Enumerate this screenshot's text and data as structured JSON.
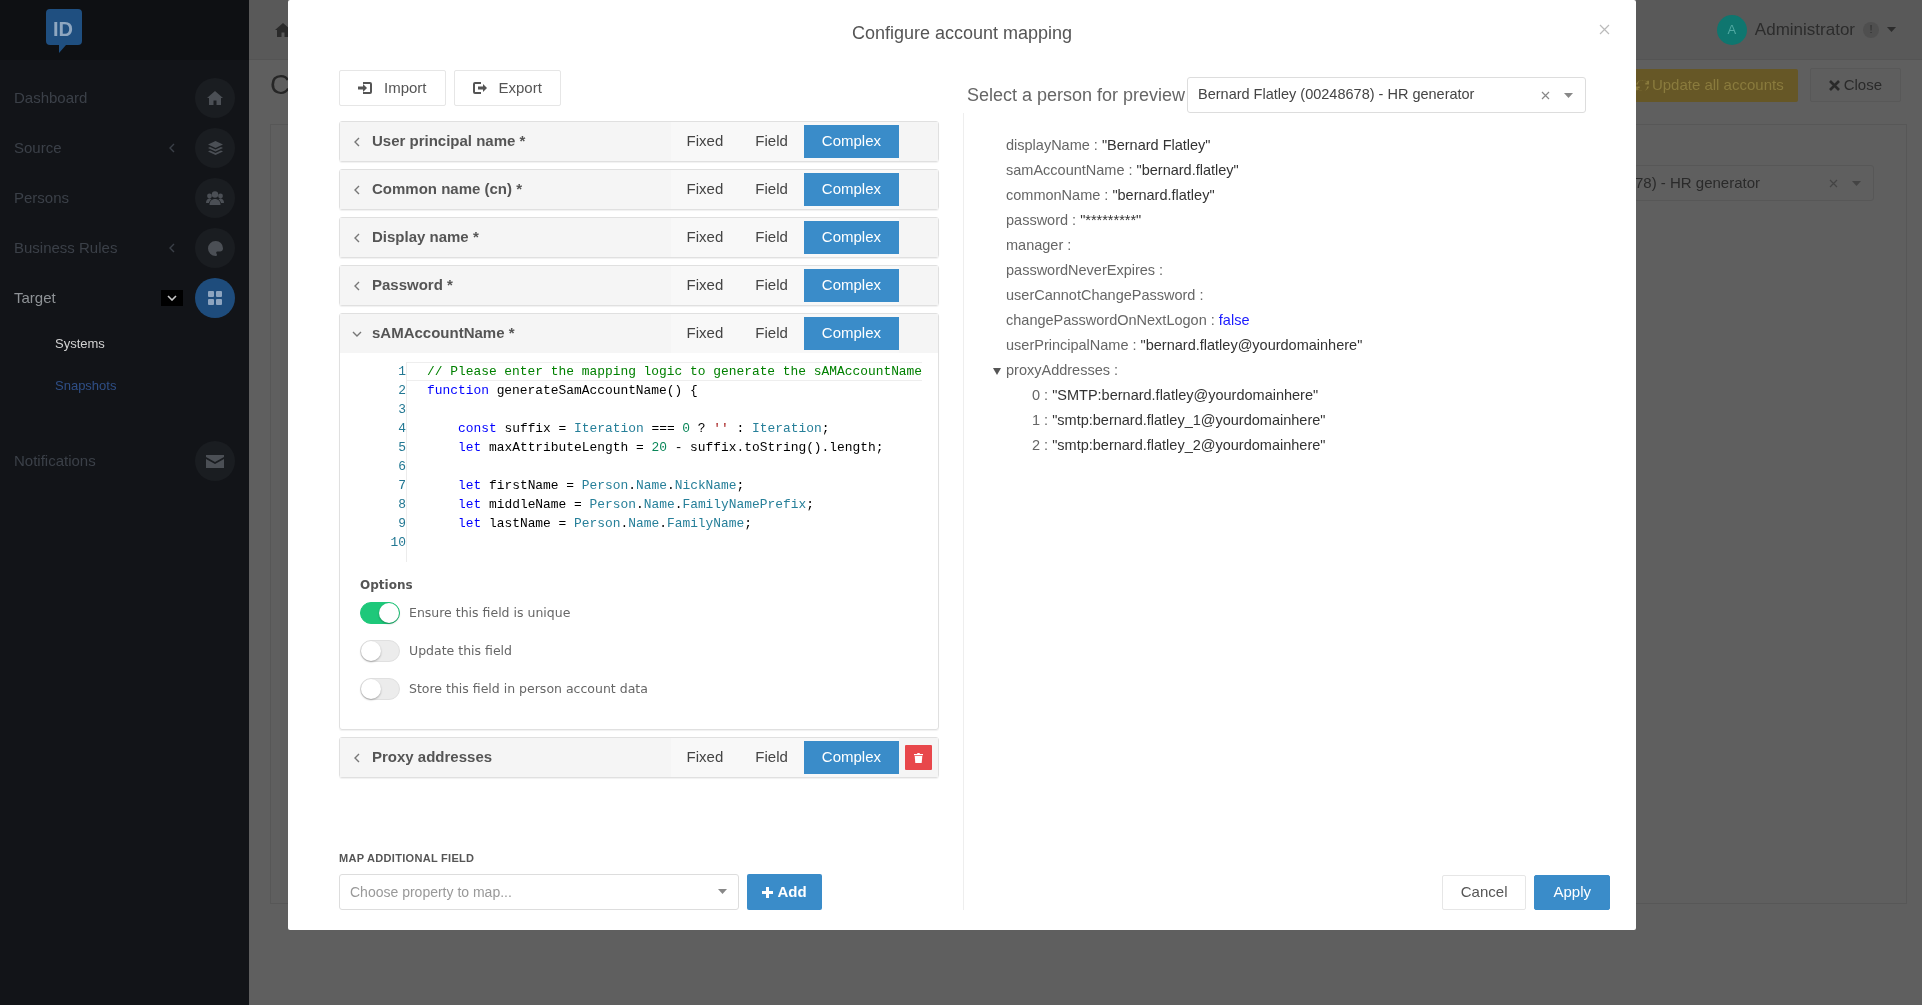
{
  "sidebar": {
    "logo": "ID",
    "items": [
      {
        "label": "Dashboard",
        "kind": "link",
        "selected": false
      },
      {
        "label": "Source",
        "kind": "group",
        "expanded": false,
        "selected": false
      },
      {
        "label": "Persons",
        "kind": "link",
        "selected": false
      },
      {
        "label": "Business Rules",
        "kind": "group",
        "expanded": false,
        "selected": false
      },
      {
        "label": "Target",
        "kind": "group",
        "expanded": true,
        "selected": true,
        "children": [
          {
            "label": "Systems",
            "selected": true
          },
          {
            "label": "Snapshots",
            "selected": false
          }
        ]
      },
      {
        "label": "Notifications",
        "kind": "link",
        "selected": false
      }
    ]
  },
  "background": {
    "title": "C",
    "user": {
      "avatar": "A",
      "name": "Administrator",
      "badge": "!"
    },
    "buttons": [
      "Update all accounts",
      "Close"
    ],
    "select_value": "78) - HR generator"
  },
  "modal": {
    "title": "Configure account mapping",
    "toolbar": [
      "Import",
      "Export"
    ],
    "mappings": [
      {
        "label": "User principal name *",
        "expanded": false,
        "deletable": false,
        "modes": [
          {
            "label": "Fixed",
            "selected": false
          },
          {
            "label": "Field",
            "selected": false
          },
          {
            "label": "Complex",
            "selected": true
          }
        ]
      },
      {
        "label": "Common name (cn) *",
        "expanded": false,
        "deletable": false,
        "modes": [
          {
            "label": "Fixed",
            "selected": false
          },
          {
            "label": "Field",
            "selected": false
          },
          {
            "label": "Complex",
            "selected": true
          }
        ]
      },
      {
        "label": "Display name *",
        "expanded": false,
        "deletable": false,
        "modes": [
          {
            "label": "Fixed",
            "selected": false
          },
          {
            "label": "Field",
            "selected": false
          },
          {
            "label": "Complex",
            "selected": true
          }
        ]
      },
      {
        "label": "Password *",
        "expanded": false,
        "deletable": false,
        "modes": [
          {
            "label": "Fixed",
            "selected": false
          },
          {
            "label": "Field",
            "selected": false
          },
          {
            "label": "Complex",
            "selected": true
          }
        ]
      },
      {
        "label": "sAMAccountName *",
        "expanded": true,
        "deletable": false,
        "modes": [
          {
            "label": "Fixed",
            "selected": false
          },
          {
            "label": "Field",
            "selected": false
          },
          {
            "label": "Complex",
            "selected": true
          }
        ],
        "code": [
          {
            "number": "1",
            "tokens": [
              {
                "text": "// Please enter the mapping logic to generate the sAMAccountName",
                "kind": "comment"
              }
            ]
          },
          {
            "number": "2",
            "tokens": [
              {
                "text": "function",
                "kind": "keyword"
              },
              {
                "text": " generateSamAccountName() {",
                "kind": "plain"
              }
            ]
          },
          {
            "number": "3"
          },
          {
            "number": "4",
            "indented": true,
            "tokens": [
              {
                "text": "const",
                "kind": "keyword"
              },
              {
                "text": " suffix = ",
                "kind": "plain"
              },
              {
                "text": "Iteration",
                "kind": "identifier"
              },
              {
                "text": " === ",
                "kind": "plain"
              },
              {
                "text": "0",
                "kind": "number"
              },
              {
                "text": " ? ",
                "kind": "plain"
              },
              {
                "text": "''",
                "kind": "string"
              },
              {
                "text": " : ",
                "kind": "plain"
              },
              {
                "text": "Iteration",
                "kind": "identifier"
              },
              {
                "text": ";",
                "kind": "plain"
              }
            ]
          },
          {
            "number": "5",
            "indented": true,
            "tokens": [
              {
                "text": "let",
                "kind": "keyword"
              },
              {
                "text": " maxAttributeLength = ",
                "kind": "plain"
              },
              {
                "text": "20",
                "kind": "number"
              },
              {
                "text": " - suffix.toString().length;",
                "kind": "plain"
              }
            ]
          },
          {
            "number": "6"
          },
          {
            "number": "7",
            "indented": true,
            "tokens": [
              {
                "text": "let",
                "kind": "keyword"
              },
              {
                "text": " firstName = ",
                "kind": "plain"
              },
              {
                "text": "Person",
                "kind": "identifier"
              },
              {
                "text": ".",
                "kind": "plain"
              },
              {
                "text": "Name",
                "kind": "identifier"
              },
              {
                "text": ".",
                "kind": "plain"
              },
              {
                "text": "NickName",
                "kind": "identifier"
              },
              {
                "text": ";",
                "kind": "plain"
              }
            ]
          },
          {
            "number": "8",
            "indented": true,
            "tokens": [
              {
                "text": "let",
                "kind": "keyword"
              },
              {
                "text": " middleName = ",
                "kind": "plain"
              },
              {
                "text": "Person",
                "kind": "identifier"
              },
              {
                "text": ".",
                "kind": "plain"
              },
              {
                "text": "Name",
                "kind": "identifier"
              },
              {
                "text": ".",
                "kind": "plain"
              },
              {
                "text": "FamilyNamePrefix",
                "kind": "identifier"
              },
              {
                "text": ";",
                "kind": "plain"
              }
            ]
          },
          {
            "number": "9",
            "indented": true,
            "tokens": [
              {
                "text": "let",
                "kind": "keyword"
              },
              {
                "text": " lastName = ",
                "kind": "plain"
              },
              {
                "text": "Person",
                "kind": "identifier"
              },
              {
                "text": ".",
                "kind": "plain"
              },
              {
                "text": "Name",
                "kind": "identifier"
              },
              {
                "text": ".",
                "kind": "plain"
              },
              {
                "text": "FamilyName",
                "kind": "identifier"
              },
              {
                "text": ";",
                "kind": "plain"
              }
            ]
          },
          {
            "number": "10"
          }
        ],
        "options_label": "Options",
        "options": [
          {
            "label": "Ensure this field is unique",
            "on": true
          },
          {
            "label": "Update this field",
            "on": false
          },
          {
            "label": "Store this field in person account data",
            "on": false
          }
        ]
      },
      {
        "label": "Proxy addresses",
        "expanded": false,
        "deletable": true,
        "modes": [
          {
            "label": "Fixed",
            "selected": false
          },
          {
            "label": "Field",
            "selected": false
          },
          {
            "label": "Complex",
            "selected": true
          }
        ]
      }
    ],
    "additional_field": {
      "label": "MAP ADDITIONAL FIELD",
      "placeholder": "Choose property to map...",
      "button": "Add"
    },
    "preview": {
      "label": "Select a person for preview",
      "value": "Bernard Flatley (00248678) - HR generator",
      "fields": [
        {
          "key": "displayName :",
          "value": "\"Bernard Flatley\"",
          "kind": "string"
        },
        {
          "key": "samAccountName :",
          "value": "\"bernard.flatley\"",
          "kind": "string"
        },
        {
          "key": "commonName :",
          "value": "\"bernard.flatley\"",
          "kind": "string"
        },
        {
          "key": "password :",
          "value": "\"*********\"",
          "kind": "string"
        },
        {
          "key": "manager :",
          "kind": "empty"
        },
        {
          "key": "passwordNeverExpires :",
          "kind": "empty"
        },
        {
          "key": "userCannotChangePassword :",
          "kind": "empty"
        },
        {
          "key": "changePasswordOnNextLogon :",
          "value": "false",
          "kind": "boolean"
        },
        {
          "key": "userPrincipalName :",
          "value": "\"bernard.flatley@yourdomainhere\"",
          "kind": "string"
        },
        {
          "key": "proxyAddresses :",
          "kind": "array",
          "expanded": true,
          "children": [
            {
              "key": "0 :",
              "value": "\"SMTP:bernard.flatley@yourdomainhere\"",
              "kind": "string"
            },
            {
              "key": "1 :",
              "value": "\"smtp:bernard.flatley_1@yourdomainhere\"",
              "kind": "string"
            },
            {
              "key": "2 :",
              "value": "\"smtp:bernard.flatley_2@yourdomainhere\"",
              "kind": "string"
            }
          ]
        }
      ]
    },
    "footer_buttons": [
      {
        "label": "Cancel",
        "kind": "secondary"
      },
      {
        "label": "Apply",
        "kind": "primary"
      }
    ]
  }
}
